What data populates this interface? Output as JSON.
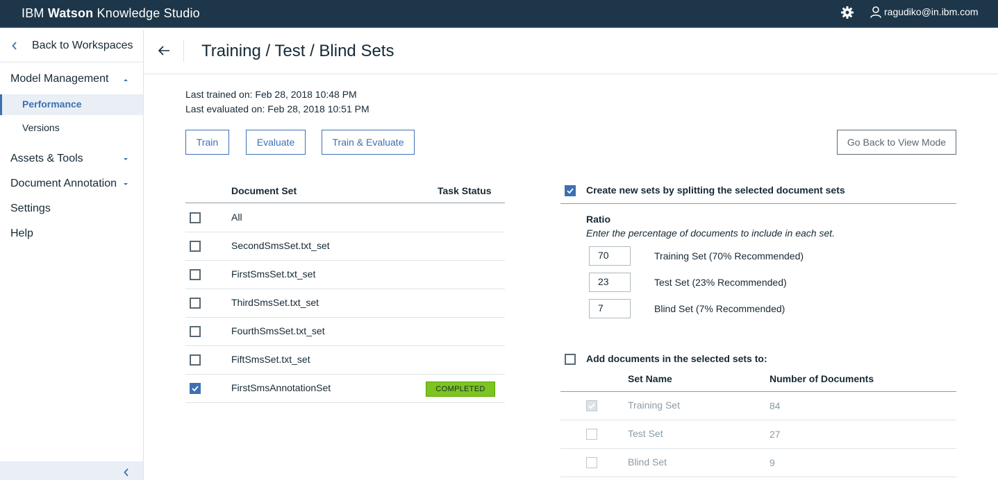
{
  "topbar": {
    "brand_prefix": "IBM",
    "brand_bold": "Watson",
    "brand_suffix": "Knowledge Studio",
    "user_email": "ragudiko@in.ibm.com"
  },
  "sidebar": {
    "back_label": "Back to Workspaces",
    "model_management": "Model Management",
    "performance": "Performance",
    "versions": "Versions",
    "assets_tools": "Assets & Tools",
    "document_annotation": "Document Annotation",
    "settings": "Settings",
    "help": "Help"
  },
  "header": {
    "title": "Training / Test / Blind Sets"
  },
  "meta": {
    "last_trained": "Last trained on: Feb 28, 2018 10:48 PM",
    "last_evaluated": "Last evaluated on: Feb 28, 2018 10:51 PM"
  },
  "buttons": {
    "train": "Train",
    "evaluate": "Evaluate",
    "train_evaluate": "Train & Evaluate",
    "go_back": "Go Back to View Mode"
  },
  "doc_table": {
    "col_set": "Document Set",
    "col_status": "Task Status",
    "rows": [
      {
        "name": "All",
        "checked": false,
        "status": ""
      },
      {
        "name": "SecondSmsSet.txt_set",
        "checked": false,
        "status": ""
      },
      {
        "name": "FirstSmsSet.txt_set",
        "checked": false,
        "status": ""
      },
      {
        "name": "ThirdSmsSet.txt_set",
        "checked": false,
        "status": ""
      },
      {
        "name": "FourthSmsSet.txt_set",
        "checked": false,
        "status": ""
      },
      {
        "name": "FiftSmsSet.txt_set",
        "checked": false,
        "status": ""
      },
      {
        "name": "FirstSmsAnnotationSet",
        "checked": true,
        "status": "COMPLETED"
      }
    ]
  },
  "split": {
    "checked": true,
    "label": "Create new sets by splitting the selected document sets",
    "ratio_title": "Ratio",
    "ratio_hint": "Enter the percentage of documents to include in each set.",
    "training_value": "70",
    "training_label": "Training Set  (70% Recommended)",
    "test_value": "23",
    "test_label": "Test Set  (23% Recommended)",
    "blind_value": "7",
    "blind_label": "Blind Set  (7% Recommended)"
  },
  "add_docs": {
    "checked": false,
    "label": "Add documents in the selected sets to:",
    "col_set": "Set Name",
    "col_count": "Number of Documents",
    "rows": [
      {
        "name": "Training Set",
        "count": "84",
        "checked": true
      },
      {
        "name": "Test Set",
        "count": "27",
        "checked": false
      },
      {
        "name": "Blind Set",
        "count": "9",
        "checked": false
      }
    ]
  },
  "colors": {
    "topbar": "#1d3649",
    "accent": "#3d70b2",
    "completed": "#7cc41f"
  }
}
